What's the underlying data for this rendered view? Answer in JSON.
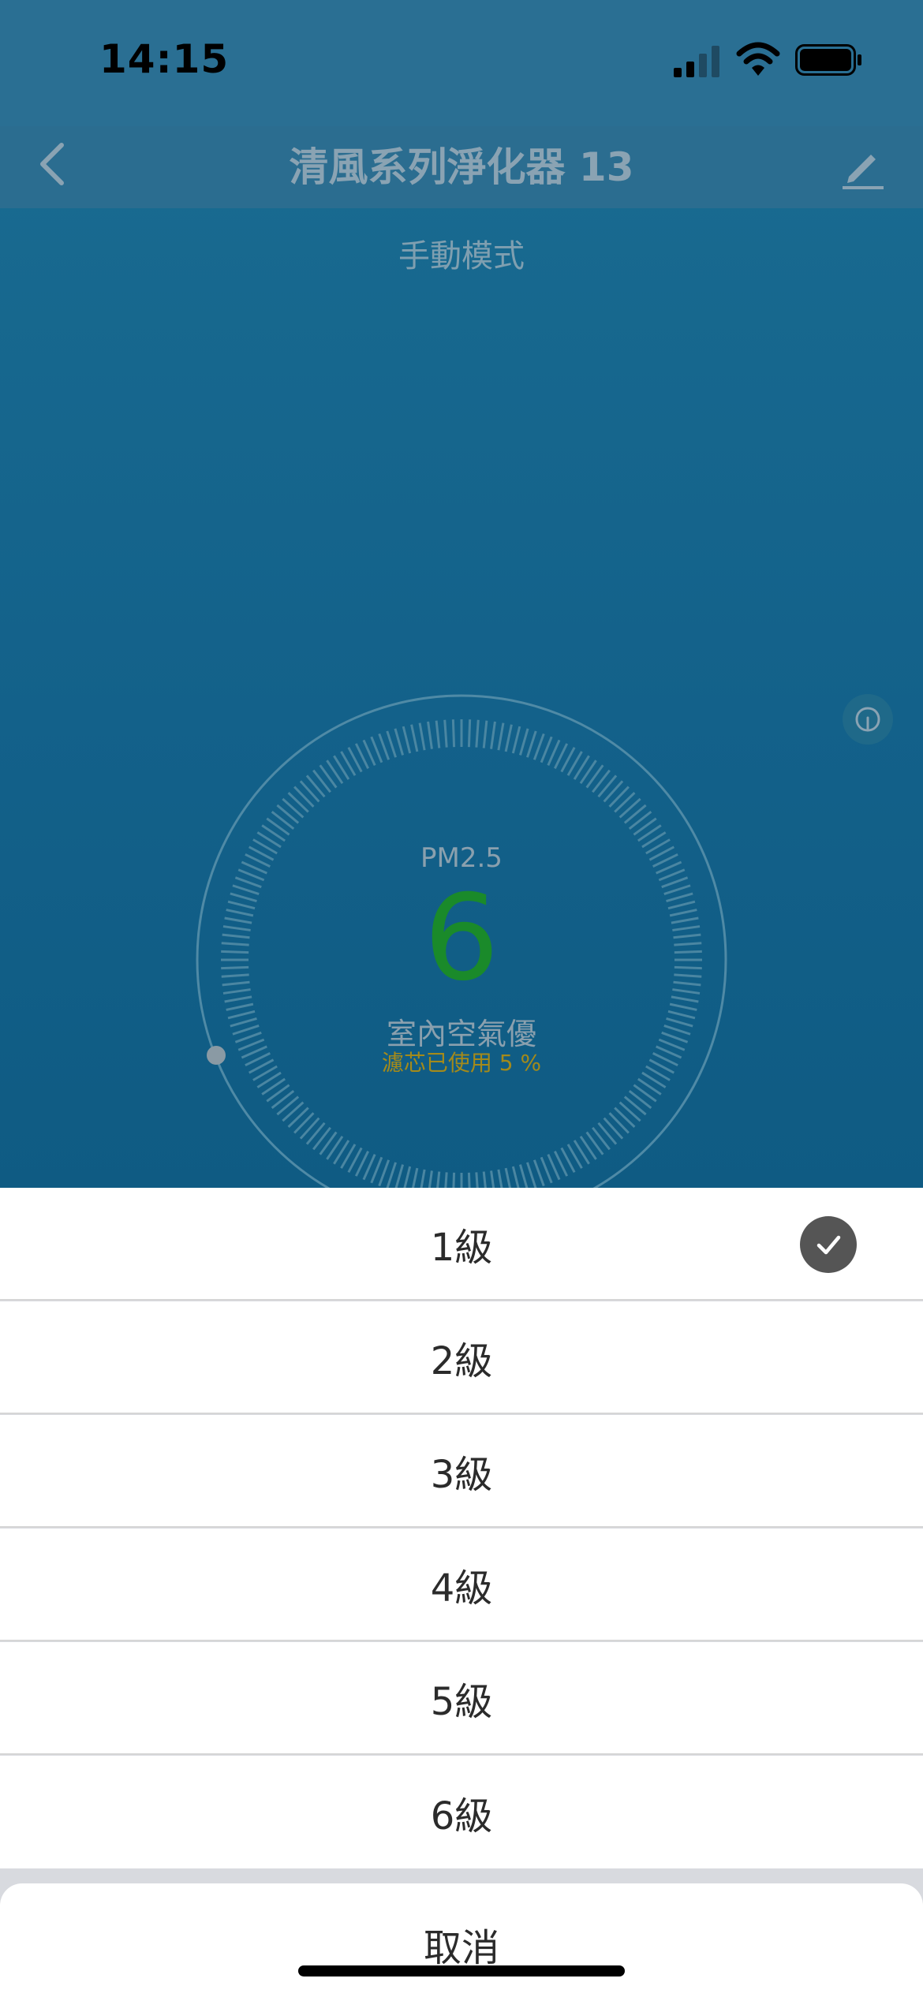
{
  "status_bar": {
    "time": "14:15"
  },
  "nav": {
    "title": "清風系列淨化器 13"
  },
  "device": {
    "mode": "手動模式",
    "pm_label": "PM2.5",
    "pm_value": "6",
    "air_quality": "室內空氣優",
    "filter_usage": "濾芯已使用 5 %"
  },
  "sheet": {
    "options": [
      {
        "label": "1級",
        "selected": true
      },
      {
        "label": "2級",
        "selected": false
      },
      {
        "label": "3級",
        "selected": false
      },
      {
        "label": "4級",
        "selected": false
      },
      {
        "label": "5級",
        "selected": false
      },
      {
        "label": "6級",
        "selected": false
      }
    ],
    "cancel_label": "取消"
  },
  "colors": {
    "background_blue": "#13618a",
    "pm_value_green": "#1a8a2a",
    "filter_text_gold": "#a48a1a",
    "check_badge": "#555555"
  },
  "icons": {
    "signal": "cellular-signal-icon",
    "wifi": "wifi-icon",
    "battery": "battery-icon",
    "back": "chevron-left-icon",
    "edit": "pencil-icon",
    "leaf": "leaf-icon",
    "check": "checkmark-icon"
  }
}
